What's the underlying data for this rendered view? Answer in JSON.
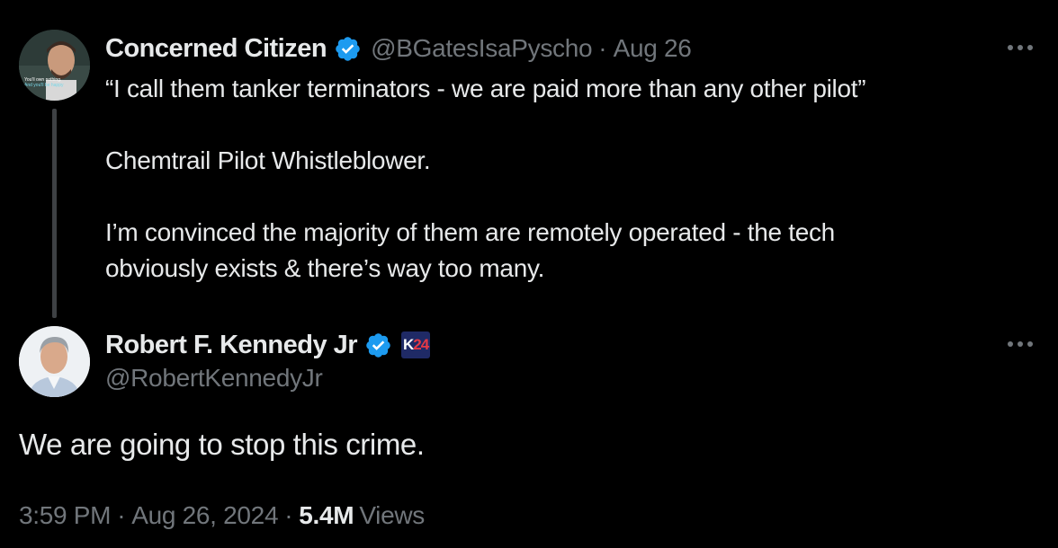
{
  "colors": {
    "background": "#000000",
    "text_primary": "#e7e9ea",
    "text_secondary": "#71767b",
    "verified_blue": "#1d9bf0",
    "thread_line": "#3e4144"
  },
  "parent_tweet": {
    "display_name": "Concerned Citizen",
    "verified_icon": "verified-badge-icon",
    "handle": "@BGatesIsaPyscho",
    "separator": "·",
    "date": "Aug 26",
    "more_icon": "more-dots-icon",
    "avatar_text": [
      "You'll own nothing.",
      "And you'll be happy"
    ],
    "body": {
      "line1": "“I call them tanker terminators - we are paid more than any other pilot”",
      "line2": "Chemtrail Pilot Whistleblower.",
      "line3a": "I’m convinced the majority of them are remotely operated - the tech",
      "line3b": "obviously exists & there’s way too many."
    }
  },
  "main_tweet": {
    "display_name": "Robert F. Kennedy Jr",
    "verified_icon": "verified-badge-icon",
    "affiliation_badge": {
      "k": "K",
      "num": "24"
    },
    "handle": "@RobertKennedyJr",
    "more_icon": "more-dots-icon",
    "text": "We are going to stop this crime.",
    "time": "3:59 PM",
    "sep1": "·",
    "date": "Aug 26, 2024",
    "sep2": "·",
    "views_count": "5.4M",
    "views_label": "Views"
  }
}
